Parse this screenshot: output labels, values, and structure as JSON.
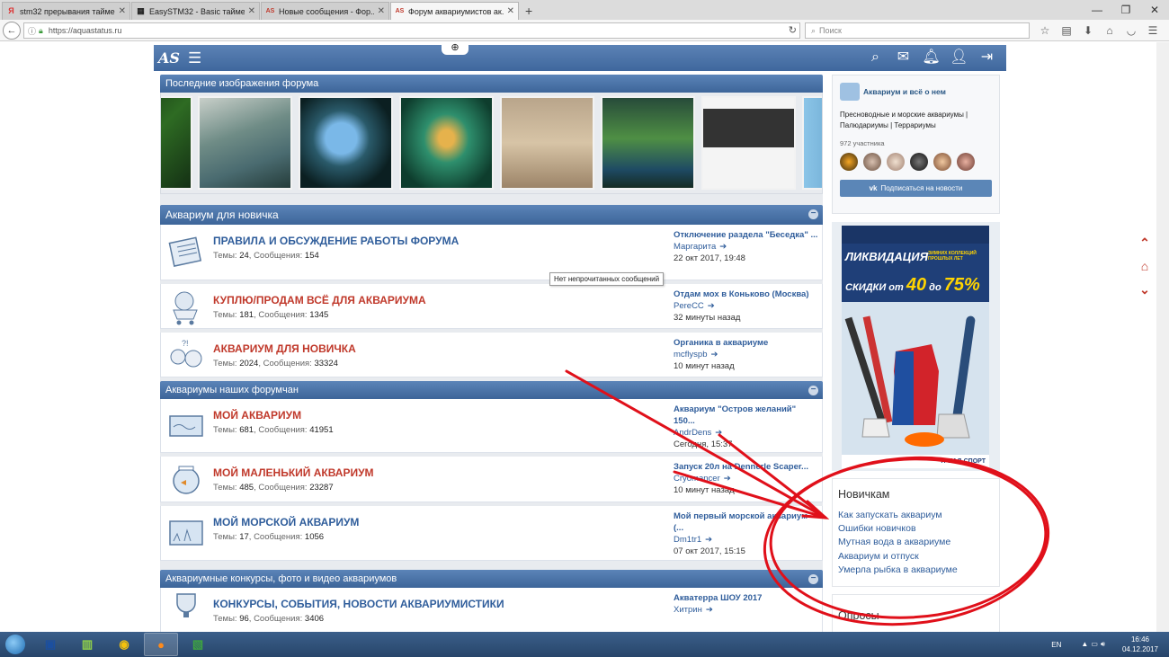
{
  "browser": {
    "tabs": [
      {
        "title": "stm32 прерывания тайме...",
        "favicon": "Я",
        "color": "#d33"
      },
      {
        "title": "EasySTM32 - Basic таймер...",
        "favicon": "▦",
        "color": "#333"
      },
      {
        "title": "Новые сообщения - Фор...",
        "favicon": "AS",
        "color": "#c0392b"
      },
      {
        "title": "Форум аквариумистов ак...",
        "favicon": "AS",
        "color": "#c0392b",
        "active": true
      }
    ],
    "url": "https://aquastatus.ru",
    "search_placeholder": "Поиск"
  },
  "site": {
    "logo": "AS"
  },
  "gallery": {
    "title": "Последние изображения форума"
  },
  "sections": [
    {
      "title": "Аквариум для новичка",
      "forums": [
        {
          "name": "ПРАВИЛА И ОБСУЖДЕНИЕ РАБОТЫ ФОРУМА",
          "red": false,
          "topics_label": "Темы:",
          "topics": "24",
          "posts_label": "Сообщения:",
          "posts": "154",
          "last_title": "Отключение раздела \"Беседка\" ...",
          "last_user": "Маргарита",
          "last_date": "22 окт 2017, 19:48",
          "icon": "notebook"
        },
        {
          "name": "КУПЛЮ/ПРОДАМ ВСЁ ДЛЯ АКВАРИУМА",
          "red": true,
          "topics_label": "Темы:",
          "topics": "181",
          "posts_label": "Сообщения:",
          "posts": "1345",
          "last_title": "Отдам мох в Коньково (Москва)",
          "last_user": "PereCC",
          "last_date": "32 минуты назад",
          "icon": "cart"
        },
        {
          "name": "АКВАРИУМ ДЛЯ НОВИЧКА",
          "red": true,
          "topics_label": "Темы:",
          "topics": "2024",
          "posts_label": "Сообщения:",
          "posts": "33324",
          "last_title": "Органика в аквариуме",
          "last_user": "mcflyspb",
          "last_date": "10 минут назад",
          "icon": "people"
        }
      ]
    },
    {
      "title": "Аквариумы наших форумчан",
      "forums": [
        {
          "name": "МОЙ АКВАРИУМ",
          "red": true,
          "topics_label": "Темы:",
          "topics": "681",
          "posts_label": "Сообщения:",
          "posts": "41951",
          "last_title": "Аквариум \"Остров желаний\" 150...",
          "last_user": "AndrDens",
          "last_date": "Сегодня, 15:37",
          "icon": "tank"
        },
        {
          "name": "МОЙ МАЛЕНЬКИЙ АКВАРИУМ",
          "red": true,
          "topics_label": "Темы:",
          "topics": "485",
          "posts_label": "Сообщения:",
          "posts": "23287",
          "last_title": "Запуск 20л на Dennerle Scaper...",
          "last_user": "Cryomancer",
          "last_date": "10 минут назад",
          "icon": "bowl"
        },
        {
          "name": "МОЙ МОРСКОЙ АКВАРИУМ",
          "red": false,
          "topics_label": "Темы:",
          "topics": "17",
          "posts_label": "Сообщения:",
          "posts": "1056",
          "last_title": "Мой первый морской аквариум (...",
          "last_user": "Dm1tr1",
          "last_date": "07 окт 2017, 15:15",
          "icon": "marine"
        }
      ]
    },
    {
      "title": "Аквариумные конкурсы, фото и видео аквариумов",
      "forums": [
        {
          "name": "КОНКУРСЫ, СОБЫТИЯ, НОВОСТИ АКВАРИУМИСТИКИ",
          "red": false,
          "topics_label": "Темы:",
          "topics": "96",
          "posts_label": "Сообщения:",
          "posts": "3406",
          "last_title": "Акватерра ШОУ 2017",
          "last_user": "Хитрин",
          "last_date": "",
          "icon": "trophy"
        }
      ]
    }
  ],
  "tooltip": "Нет непрочитанных сообщений",
  "vk_widget": {
    "name": "Аквариум и всё о нем",
    "description": "Пресноводные и морские аквариумы | Палюдариумы | Террариумы",
    "members": "972 участника",
    "subscribe": "Подписаться на новости"
  },
  "ad": {
    "headline": "ЛИКВИДАЦИЯ",
    "sub": "ЗИМНИХ КОЛЛЕКЦИЙ ПРОШЛЫХ ЛЕТ",
    "discount_prefix": "СКИДКИ от",
    "discount_from": "40",
    "discount_mid": "до",
    "discount_to": "75%",
    "brand": "ТРИАЛ-СПОРТ"
  },
  "newbie_block": {
    "title": "Новичкам",
    "links": [
      "Как запускать аквариум",
      "Ошибки новичков",
      "Мутная вода в аквариуме",
      "Аквариум и отпуск",
      "Умерла рыбка в аквариуме"
    ]
  },
  "polls_block": {
    "title": "Опросы"
  },
  "taskbar": {
    "lang": "EN",
    "time": "16:46",
    "date": "04.12.2017"
  },
  "colors": {
    "header_blue": "#3f679d",
    "link_blue": "#2f5d9b",
    "forum_red": "#c0392b",
    "annotation_red": "#e0101a"
  }
}
